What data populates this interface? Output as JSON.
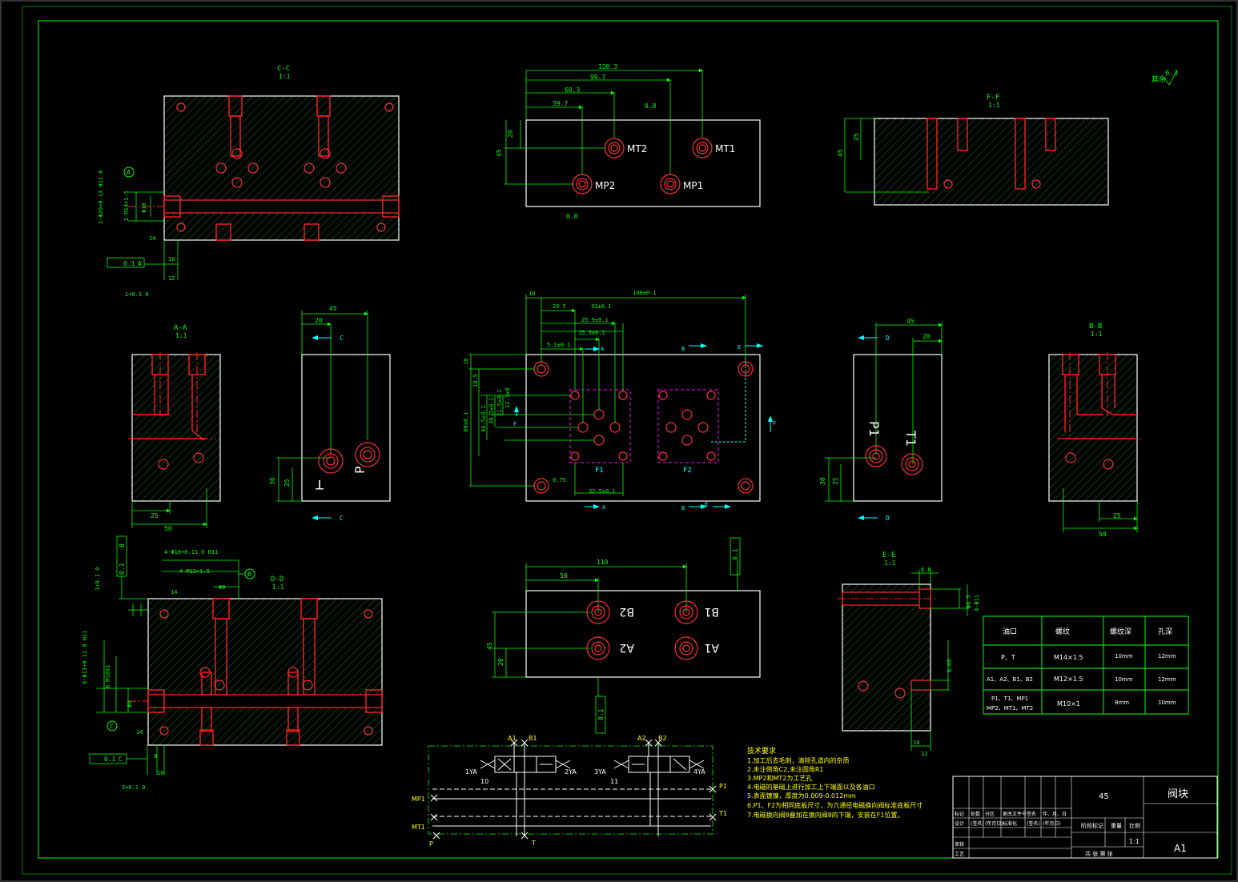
{
  "views": {
    "cc": {
      "title": "C-C",
      "scale": "1:1"
    },
    "ff": {
      "title": "F-F",
      "scale": "1:1"
    },
    "aa": {
      "title": "A-A",
      "scale": "1:1"
    },
    "bb": {
      "title": "B-B",
      "scale": "1:1"
    },
    "dd": {
      "title": "D-D",
      "scale": "1:1"
    },
    "ee": {
      "title": "E-E",
      "scale": "1:1"
    }
  },
  "roughness_corner": {
    "prefix": "其余",
    "value": "6.3"
  },
  "top_view": {
    "dims": [
      "120.3",
      "99.7",
      "60.3",
      "39.7",
      "20",
      "45"
    ],
    "roughness": [
      "0.8",
      "0.8"
    ],
    "ports": [
      "MT2",
      "MT1",
      "MP2",
      "MP1"
    ]
  },
  "main_view": {
    "dims": [
      "10",
      "140±0.1",
      "24.5",
      "31±0.1",
      "25.9±0.1",
      "15.5±0.1",
      "5.1±0.1",
      "10",
      "18.5",
      "40.5±0.1",
      "30.2±0.1",
      "21.5±0.1",
      "12.7±0",
      "80±0.1",
      "0.75",
      "32.5±0.1"
    ],
    "section_marks": [
      "A",
      "B",
      "E",
      "F",
      "A",
      "B",
      "E",
      "F"
    ],
    "pad_labels": [
      "F1",
      "F2"
    ]
  },
  "left_side": {
    "dims": [
      "45",
      "20",
      "30",
      "25"
    ],
    "ports": [
      "T",
      "P"
    ],
    "section": [
      "C",
      "C"
    ]
  },
  "right_side": {
    "dims": [
      "45",
      "20",
      "30",
      "25"
    ],
    "ports": [
      "P1",
      "T1"
    ],
    "section": [
      "D",
      "D"
    ]
  },
  "aa_dims": [
    "25",
    "50"
  ],
  "bb_dims": [
    "25",
    "50"
  ],
  "cc_dims": [
    "2-Φ20+0.13 H11 0",
    "2-M14×1.5",
    "Φ10",
    "10",
    "12",
    "1+0.1 0",
    "0.1",
    "A",
    "A",
    "14"
  ],
  "dd_dims": [
    "4-Φ18+0.11 0 H11",
    "4-M12×1.5",
    "Φ8",
    "14",
    "1+0.1 0",
    "0.1",
    "B",
    "B",
    "6-Φ13+0.11 0 H11",
    "6-M10X1",
    "Φ8",
    "0.1",
    "C",
    "C",
    "8",
    "10",
    "14",
    "2+0.1 0"
  ],
  "bottom_view": {
    "dims": [
      "110",
      "50",
      "45",
      "20"
    ],
    "ports": [
      "B2",
      "B1",
      "A2",
      "A1"
    ],
    "tol": [
      "0.1",
      "0.1"
    ]
  },
  "ee_dims": [
    "6.8",
    "Φ6.5",
    "4-Φ11",
    "8-M5",
    "12",
    "10"
  ],
  "port_table": {
    "headers": [
      "油口",
      "螺纹",
      "螺纹深",
      "孔深"
    ],
    "rows": [
      [
        "P、T",
        "M14×1.5",
        "10mm",
        "12mm"
      ],
      [
        "A1、A2、B1、B2",
        "M12×1.5",
        "10mm",
        "12mm"
      ],
      [
        "P1、T1、MP1",
        "M10×1",
        "8mm",
        "10mm"
      ]
    ],
    "row3_line2": "MP2、MT1、MT2"
  },
  "hydraulic": {
    "labels": [
      "A1",
      "B1",
      "A2",
      "B2",
      "1YA",
      "2YA",
      "3YA",
      "4YA",
      "10",
      "11",
      "MP1",
      "MT1",
      "P1",
      "T1",
      "P",
      "T"
    ]
  },
  "notes": {
    "title": "技术要求",
    "items": [
      "1.加工后去毛刺，清除孔道内的杂质",
      "2.未注倒角C2,未注圆角R1",
      "3.MP2和MT2为工艺孔",
      "4.电磁的基础上进行加工上下端面以及各油口",
      "5.表面镀镍，厚度为0.009-0.012mm",
      "6.P1、F2为相同底板尺寸，为六通径电磁换向阀标准底板尺寸",
      "7.电磁换向阀8叠加在换向阀8的下端，安装在F1位置。"
    ]
  },
  "title_block": {
    "material": "45",
    "name": "阀块",
    "drawing_no": "A1",
    "scale": "1:1",
    "row1": [
      "标记",
      "处数",
      "分区",
      "更改文件号",
      "签名",
      "年、月、日"
    ],
    "row2": [
      "设计",
      "(签名)",
      "(年月日)",
      "标准化",
      "(签名)",
      "(年月日)"
    ],
    "stage": [
      "阶段标记",
      "重量",
      "比例"
    ],
    "row3": [
      "审核"
    ],
    "row4": [
      "工艺"
    ],
    "sheets": "共  张  第  张"
  }
}
